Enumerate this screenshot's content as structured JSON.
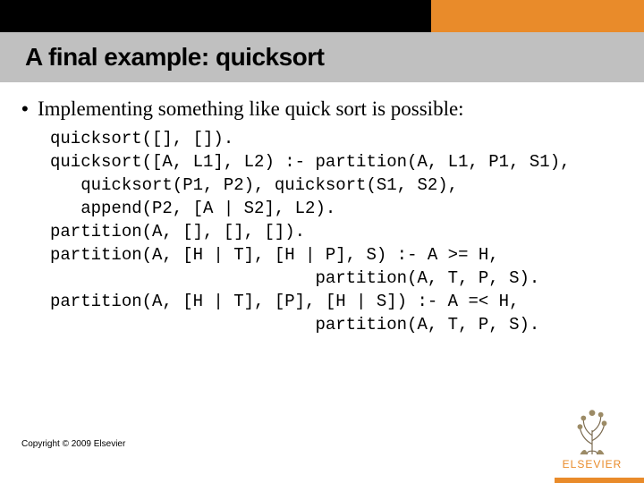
{
  "header": {
    "title": "A final example: quicksort"
  },
  "body": {
    "bullet": "Implementing something like quick sort is possible:",
    "code": "quicksort([], []).\nquicksort([A, L1], L2) :- partition(A, L1, P1, S1),\n   quicksort(P1, P2), quicksort(S1, S2),\n   append(P2, [A | S2], L2).\npartition(A, [], [], []).\npartition(A, [H | T], [H | P], S) :- A >= H,\n                          partition(A, T, P, S).\npartition(A, [H | T], [P], [H | S]) :- A =< H,\n                          partition(A, T, P, S)."
  },
  "footer": {
    "copyright": "Copyright © 2009 Elsevier",
    "logo_word": "ELSEVIER"
  },
  "colors": {
    "orange": "#e98b2a",
    "grey": "#c0c0c0"
  }
}
